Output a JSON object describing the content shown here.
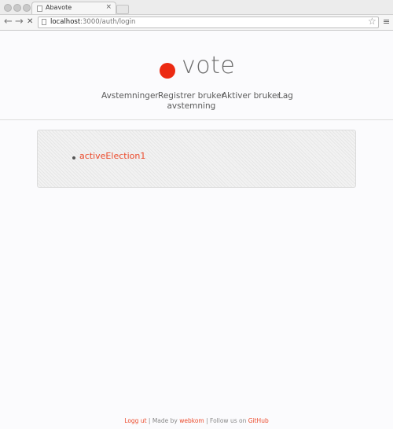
{
  "browser": {
    "tab_title": "Abavote",
    "tab_close": "×",
    "url_host": "localhost",
    "url_path": ":3000/auth/login",
    "back_glyph": "←",
    "forward_glyph": "→",
    "stop_glyph": "✕",
    "star_glyph": "☆",
    "menu_glyph": "≡"
  },
  "logo": {
    "text": "vote",
    "dot_color": "#ec2a12"
  },
  "nav": {
    "items": [
      {
        "label": "Avstemninger"
      },
      {
        "label": "Registrer bruker",
        "label2": "avstemning"
      },
      {
        "label": "Aktiver bruker"
      },
      {
        "label": "Lag"
      }
    ]
  },
  "elections": [
    {
      "name": "activeElection1"
    }
  ],
  "footer": {
    "logout": "Logg ut",
    "sep1": " | Made by ",
    "made_by": "webkom",
    "sep2": " | Follow us on ",
    "github": "GitHub"
  },
  "colors": {
    "accent": "#ec4a2b",
    "text": "#5a5a5a"
  }
}
